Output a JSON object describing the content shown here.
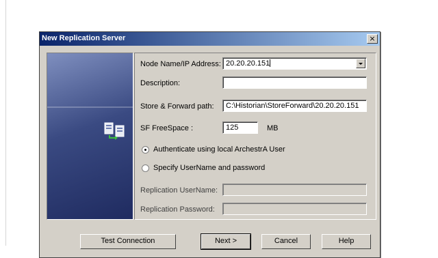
{
  "dialog": {
    "title": "New Replication Server",
    "close_glyph": "×"
  },
  "form": {
    "node_label": "Node Name/IP Address:",
    "node_value": "20.20.20.151",
    "description_label": "Description:",
    "description_value": "",
    "sf_path_label": "Store & Forward path:",
    "sf_path_value": "C:\\Historian\\StoreForward\\20.20.20.151",
    "sf_free_label": "SF FreeSpace :",
    "sf_free_value": "125",
    "sf_free_unit": "MB",
    "auth_local_label": "Authenticate using local ArchestrA User",
    "auth_custom_label": "Specify UserName and password",
    "rep_user_label": "Replication UserName:",
    "rep_pass_label": "Replication Password:"
  },
  "buttons": {
    "test": "Test Connection",
    "next": "Next >",
    "cancel": "Cancel",
    "help": "Help"
  },
  "icons": {
    "side": "server-replication-icon",
    "close": "close-icon",
    "dropdown": "chevron-down-icon"
  }
}
